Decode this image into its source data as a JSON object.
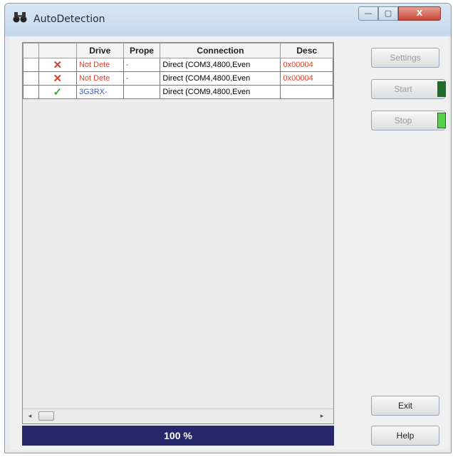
{
  "window": {
    "title": "AutoDetection",
    "controls": {
      "minimize": "—",
      "maximize": "▢",
      "close": "X"
    }
  },
  "grid": {
    "columns": [
      "",
      "",
      "Drive",
      "Prope",
      "Connection",
      "Desc"
    ],
    "rows": [
      {
        "status": "fail",
        "status_glyph": "✕",
        "drive": "Not Dete",
        "property": "-",
        "connection": "Direct (COM3,4800,Even",
        "description": "0x00004"
      },
      {
        "status": "fail",
        "status_glyph": "✕",
        "drive": "Not Dete",
        "property": "-",
        "connection": "Direct (COM4,4800,Even",
        "description": "0x00004"
      },
      {
        "status": "ok",
        "status_glyph": "✓",
        "drive": "3G3RX-",
        "property": "",
        "connection": "Direct (COM9,4800,Even",
        "description": ""
      }
    ],
    "scroll": {
      "left_arrow": "◂",
      "right_arrow": "▸"
    }
  },
  "progress": {
    "label": "100 %",
    "value": 1.0
  },
  "buttons": {
    "settings": "Settings",
    "start": "Start",
    "stop": "Stop",
    "exit": "Exit",
    "help": "Help"
  },
  "colors": {
    "progress_bar": "#27286b",
    "fail_text": "#e0432f",
    "ok_text": "#3e5fb5",
    "led_start": "#1e6b2a",
    "led_stop": "#57d148"
  },
  "icons": {
    "app": "binoculars-icon"
  }
}
